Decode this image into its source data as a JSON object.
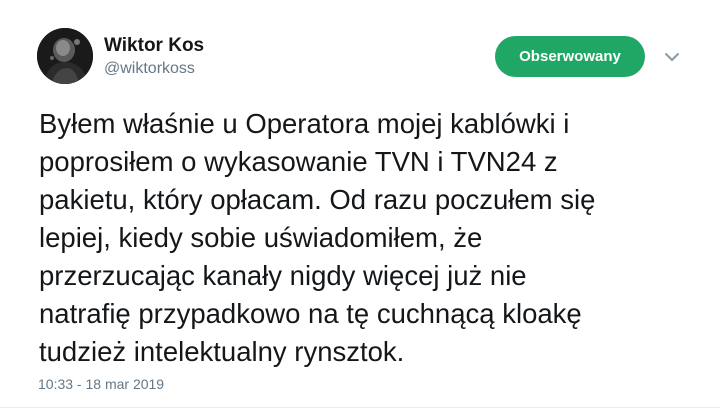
{
  "user": {
    "display_name": "Wiktor Kos",
    "handle": "@wiktorkoss"
  },
  "follow_button": {
    "label": "Obserwowany"
  },
  "tweet": {
    "lines": [
      "Byłem właśnie u Operatora mojej kablówki i",
      "poprosiłem o wykasowanie TVN i TVN24 z",
      "pakietu, który opłacam. Od razu poczułem się",
      "lepiej, kiedy sobie uświadomiłem, że",
      "przerzucając kanały nigdy więcej już nie",
      "natrafię przypadkowo na tę cuchnącą kloakę",
      "tudzież intelektualny rynsztok."
    ],
    "timestamp": "10:33 - 18 mar 2019"
  },
  "colors": {
    "follow_button_bg": "#20a765",
    "secondary_text": "#657786",
    "primary_text": "#14171a"
  },
  "icons": {
    "avatar": "avatar",
    "more": "chevron-down-icon"
  }
}
